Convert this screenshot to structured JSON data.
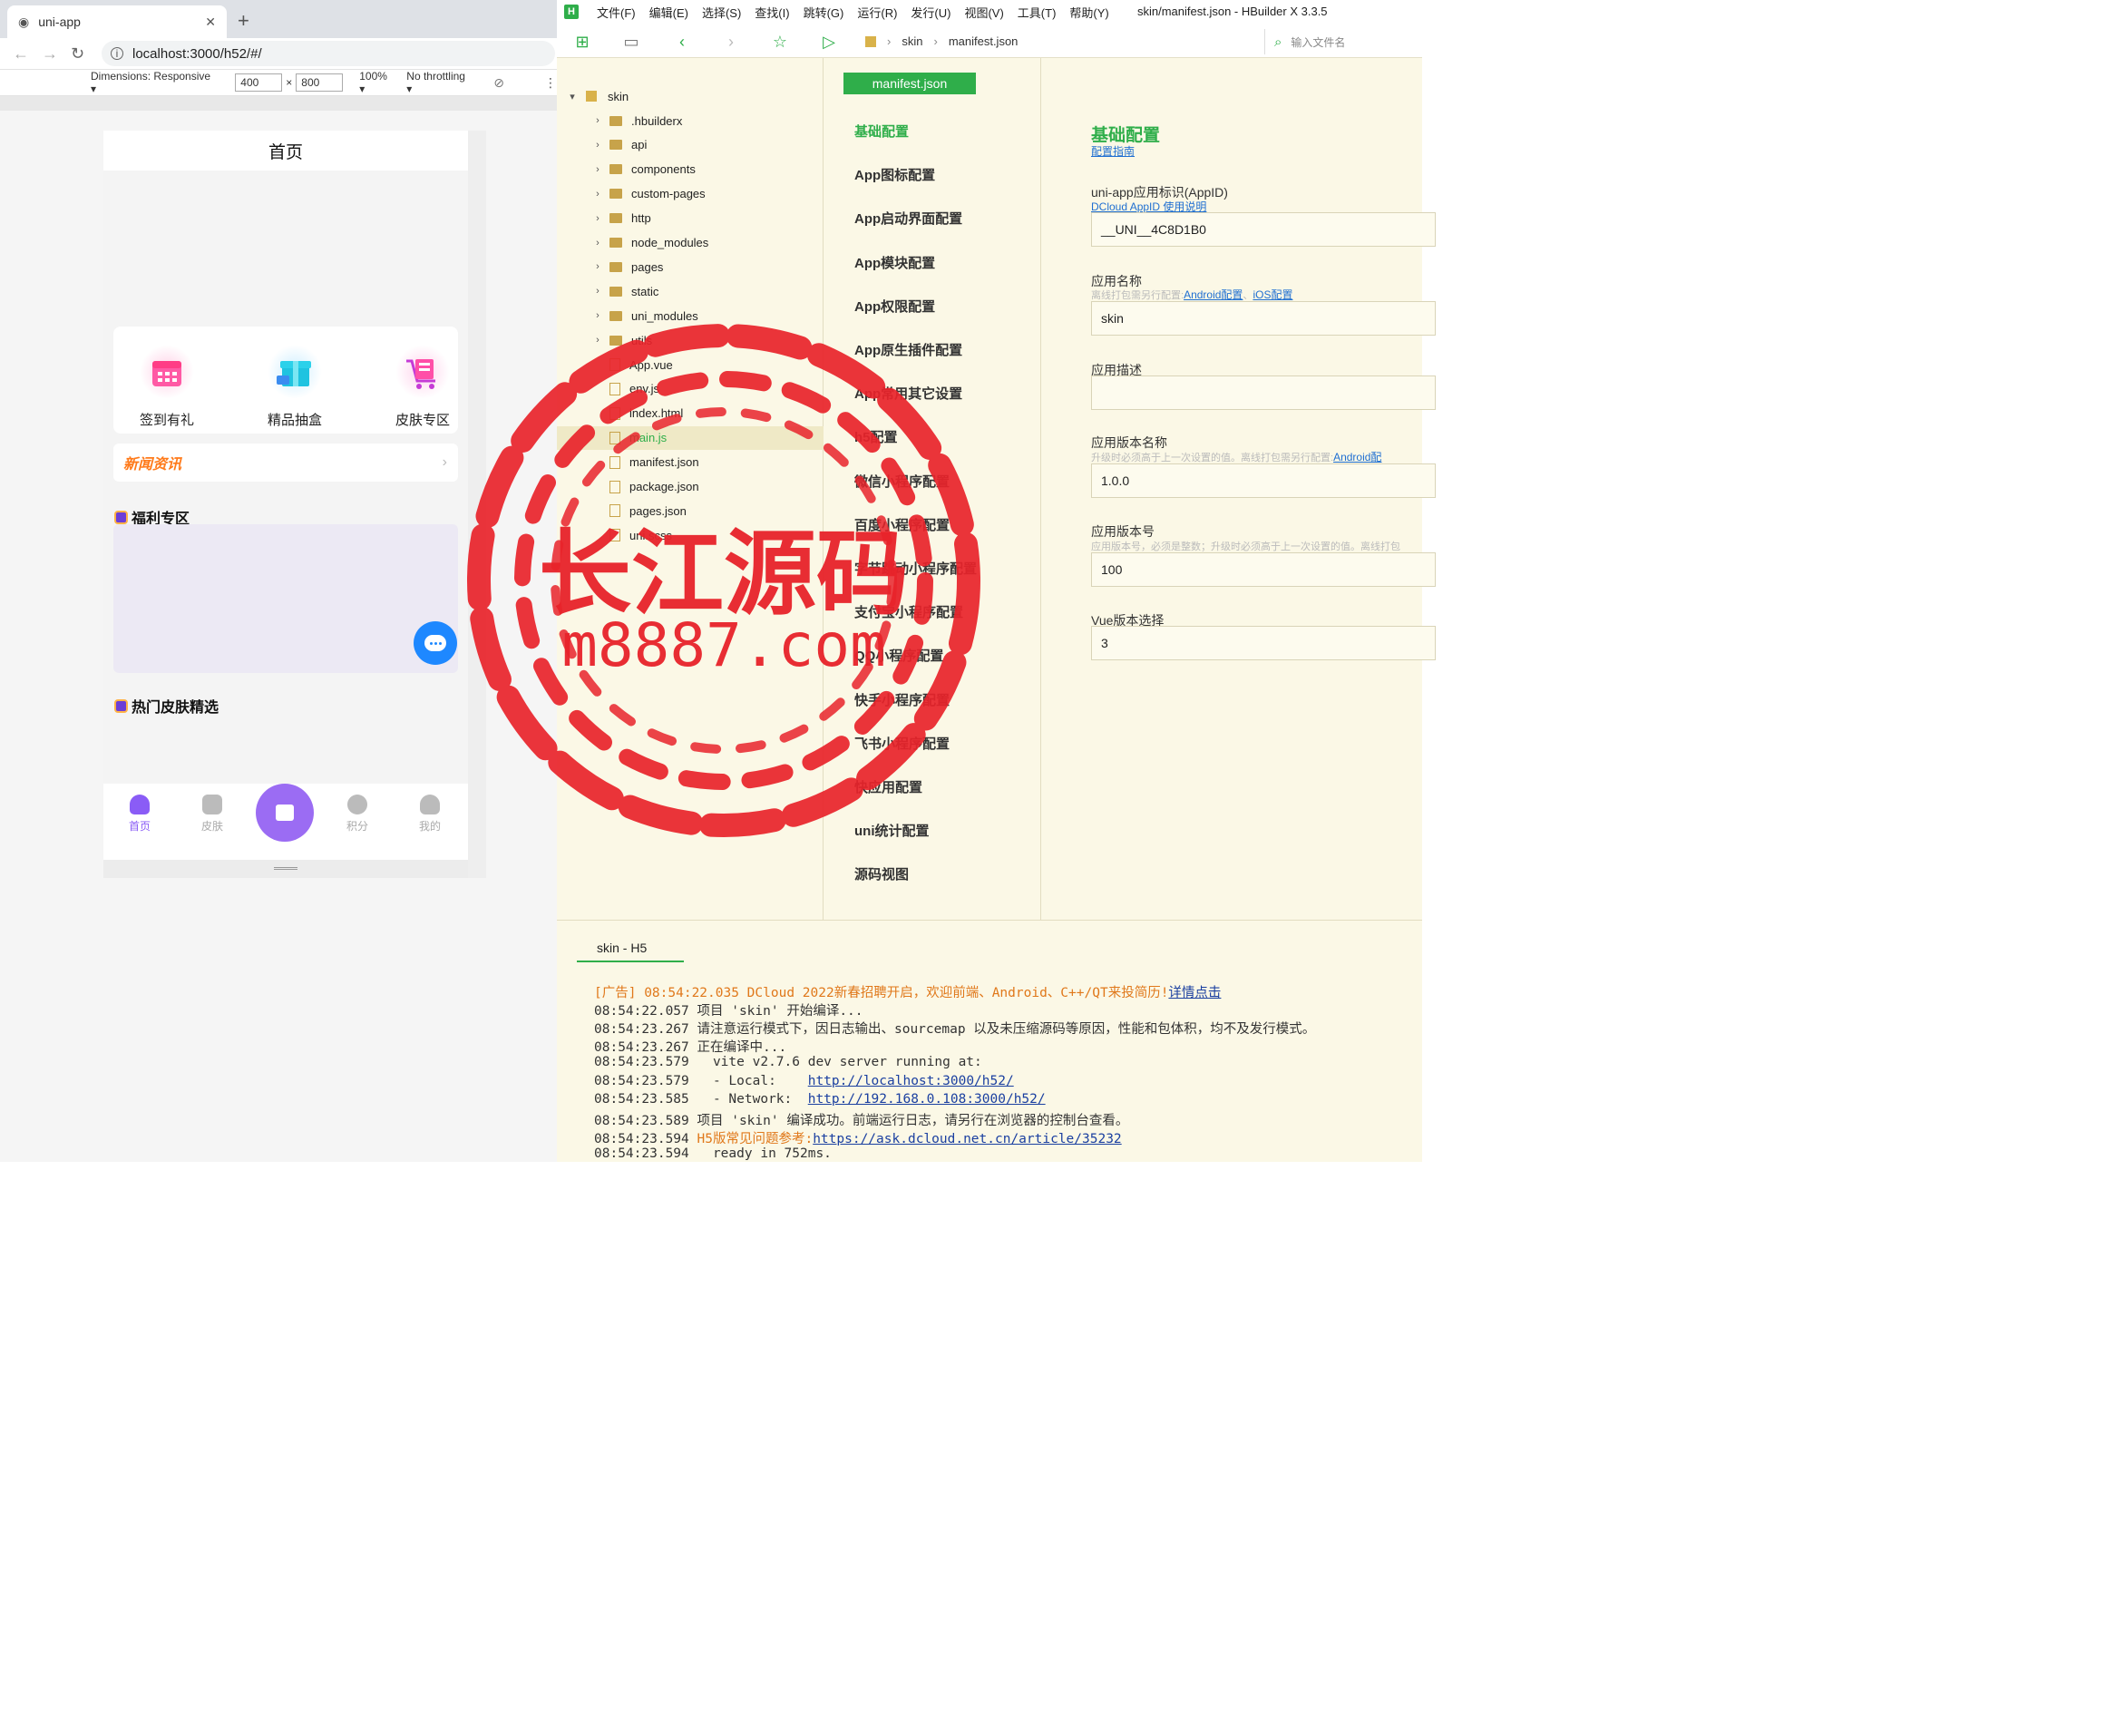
{
  "browser": {
    "tab_title": "uni-app",
    "url": "localhost:3000/h52/#/",
    "devtools": {
      "dimensions_label": "Dimensions: Responsive",
      "width": "400",
      "height": "800",
      "zoom": "100%",
      "throttling": "No throttling"
    }
  },
  "app": {
    "header_title": "首页",
    "quick_items": [
      {
        "label": "签到有礼",
        "icon": "calendar-gift-icon"
      },
      {
        "label": "精品抽盒",
        "icon": "gift-box-icon"
      },
      {
        "label": "皮肤专区",
        "icon": "shopping-cart-icon"
      }
    ],
    "news_title": "新闻资讯",
    "welfare_title": "福利专区",
    "hot_title": "热门皮肤精选",
    "tabbar": [
      {
        "label": "首页",
        "active": true
      },
      {
        "label": "皮肤",
        "active": false
      },
      {
        "label": "积分",
        "active": false
      },
      {
        "label": "我的",
        "active": false
      }
    ],
    "accent_color": "#8a5cf6"
  },
  "ide": {
    "logo": "H",
    "menu": [
      "文件(F)",
      "编辑(E)",
      "选择(S)",
      "查找(I)",
      "跳转(G)",
      "运行(R)",
      "发行(U)",
      "视图(V)",
      "工具(T)",
      "帮助(Y)"
    ],
    "window_title": "skin/manifest.json - HBuilder X 3.3.5",
    "breadcrumb": [
      "skin",
      "manifest.json"
    ],
    "file_search_placeholder": "输入文件名",
    "tree": {
      "root": "skin",
      "items": [
        {
          "name": ".hbuilderx",
          "type": "folder"
        },
        {
          "name": "api",
          "type": "folder"
        },
        {
          "name": "components",
          "type": "folder"
        },
        {
          "name": "custom-pages",
          "type": "folder"
        },
        {
          "name": "http",
          "type": "folder"
        },
        {
          "name": "node_modules",
          "type": "folder"
        },
        {
          "name": "pages",
          "type": "folder"
        },
        {
          "name": "static",
          "type": "folder"
        },
        {
          "name": "uni_modules",
          "type": "folder"
        },
        {
          "name": "utils",
          "type": "folder"
        },
        {
          "name": "App.vue",
          "type": "file"
        },
        {
          "name": "env.js",
          "type": "file"
        },
        {
          "name": "index.html",
          "type": "file"
        },
        {
          "name": "main.js",
          "type": "file",
          "selected": true
        },
        {
          "name": "manifest.json",
          "type": "file"
        },
        {
          "name": "package.json",
          "type": "file"
        },
        {
          "name": "pages.json",
          "type": "file"
        },
        {
          "name": "uni.scss",
          "type": "file"
        }
      ]
    },
    "config_tab": "manifest.json",
    "config_nav": [
      "基础配置",
      "App图标配置",
      "App启动界面配置",
      "App模块配置",
      "App权限配置",
      "App原生插件配置",
      "App常用其它设置",
      "h5配置",
      "微信小程序配置",
      "百度小程序配置",
      "字节跳动小程序配置",
      "支付宝小程序配置",
      "QQ小程序配置",
      "快手小程序配置",
      "飞书小程序配置",
      "快应用配置",
      "uni统计配置",
      "源码视图"
    ],
    "form": {
      "heading": "基础配置",
      "guide_link": "配置指南",
      "appid_label": "uni-app应用标识(AppID)",
      "appid_link": "DCloud AppID 使用说明",
      "appid_value": "__UNI__4C8D1B0",
      "name_label": "应用名称",
      "name_hint": "离线打包需另行配置:",
      "name_hint_link1": "Android配置",
      "name_hint_link2": "iOS配置",
      "name_value": "skin",
      "desc_label": "应用描述",
      "desc_value": "",
      "version_name_label": "应用版本名称",
      "version_name_hint": "升级时必须高于上一次设置的值。离线打包需另行配置:",
      "version_name_hint_link": "Android配",
      "version_name_value": "1.0.0",
      "version_code_label": "应用版本号",
      "version_code_hint": "应用版本号，必须是整数；升级时必须高于上一次设置的值。离线打包",
      "version_code_value": "100",
      "vue_label": "Vue版本选择",
      "vue_value": "3"
    },
    "console": {
      "tab": "skin - H5",
      "lines": [
        {
          "time": "",
          "text": "",
          "ad_prefix": "[广告] 08:54:22.035 DCloud 2022新春招聘开启，欢迎前端、Android、C++/QT来投简历!",
          "link": "详情点击"
        },
        {
          "time": "08:54:22.057",
          "text": " 项目 'skin' 开始编译..."
        },
        {
          "time": "08:54:23.267",
          "text": " 请注意运行模式下，因日志输出、sourcemap 以及未压缩源码等原因，性能和包体积，均不及发行模式。"
        },
        {
          "time": "08:54:23.267",
          "text": " 正在编译中..."
        },
        {
          "time": "08:54:23.579",
          "text": "   vite v2.7.6 dev server running at:"
        },
        {
          "time": "08:54:23.579",
          "text": "   - Local:    ",
          "link": "http://localhost:3000/h52/"
        },
        {
          "time": "08:54:23.585",
          "text": "   - Network:  ",
          "link": "http://192.168.0.108:3000/h52/"
        },
        {
          "time": "08:54:23.589",
          "text": " 项目 'skin' 编译成功。前端运行日志，请另行在浏览器的控制台查看。"
        },
        {
          "time": "08:54:23.594",
          "text": " ",
          "ad_mid": "H5版常见问题参考:",
          "link": "https://ask.dcloud.net.cn/article/35232"
        },
        {
          "time": "08:54:23.594",
          "text": "   ready in 752ms."
        }
      ]
    },
    "accent_color": "#2fae4a"
  },
  "watermark": {
    "title": "长江源码",
    "domain": "m8887.com",
    "color": "#e8232a"
  }
}
